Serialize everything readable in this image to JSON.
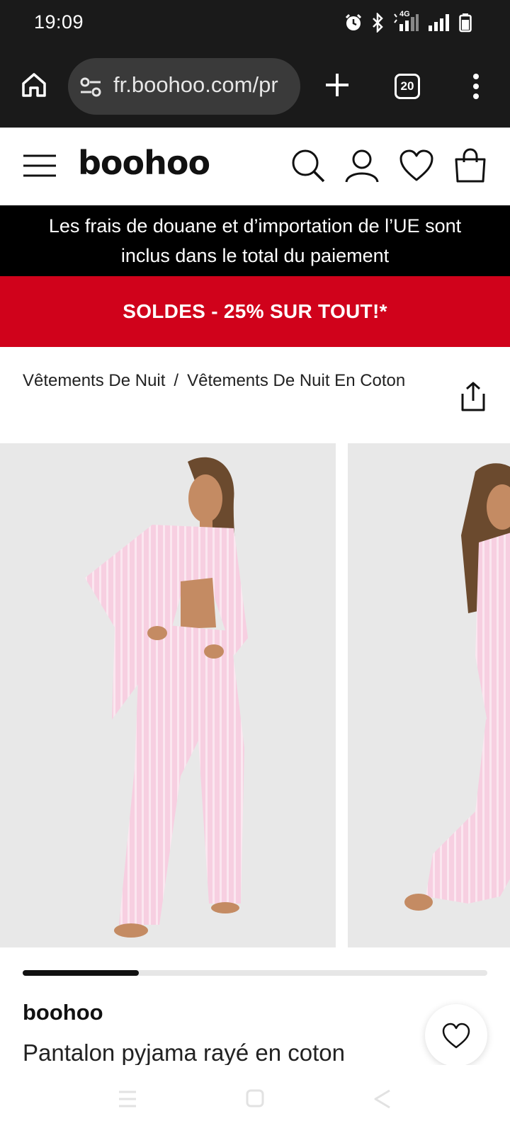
{
  "status_bar": {
    "time": "19:09",
    "icons": [
      "alarm-icon",
      "bluetooth-icon",
      "4g-signal-icon",
      "signal-icon",
      "battery-icon"
    ],
    "network_label": "4G"
  },
  "browser": {
    "url": "fr.boohoo.com/pr",
    "tab_count": "20",
    "icons": [
      "home-icon",
      "site-settings-icon",
      "new-tab-plus-icon",
      "tab-switcher-icon",
      "more-vertical-icon"
    ]
  },
  "header": {
    "logo": "boohoo",
    "icons": [
      "menu-icon",
      "search-icon",
      "account-icon",
      "wishlist-heart-icon",
      "shopping-bag-icon"
    ]
  },
  "duty_banner": {
    "line1": "Les frais de douane et d’importation de l’UE sont",
    "line2": "inclus dans le total du paiement"
  },
  "sale_banner": {
    "text": "SOLDES - 25% SUR TOUT!*"
  },
  "colors": {
    "sale_red": "#d0021b",
    "banner_black": "#000000",
    "photo_bg": "#e8e8e8",
    "pajama_pink": "#f5c6dd"
  },
  "breadcrumb": {
    "items": [
      "Vêtements De Nuit",
      "Vêtements De Nuit En Coton"
    ],
    "separator": "/"
  },
  "gallery": {
    "progress_fraction": 0.25
  },
  "product": {
    "brand": "boohoo",
    "title": "Pantalon pyjama rayé en coton"
  },
  "nav_bar": {
    "icons": [
      "recent-apps-icon",
      "home-button-icon",
      "back-icon"
    ]
  }
}
